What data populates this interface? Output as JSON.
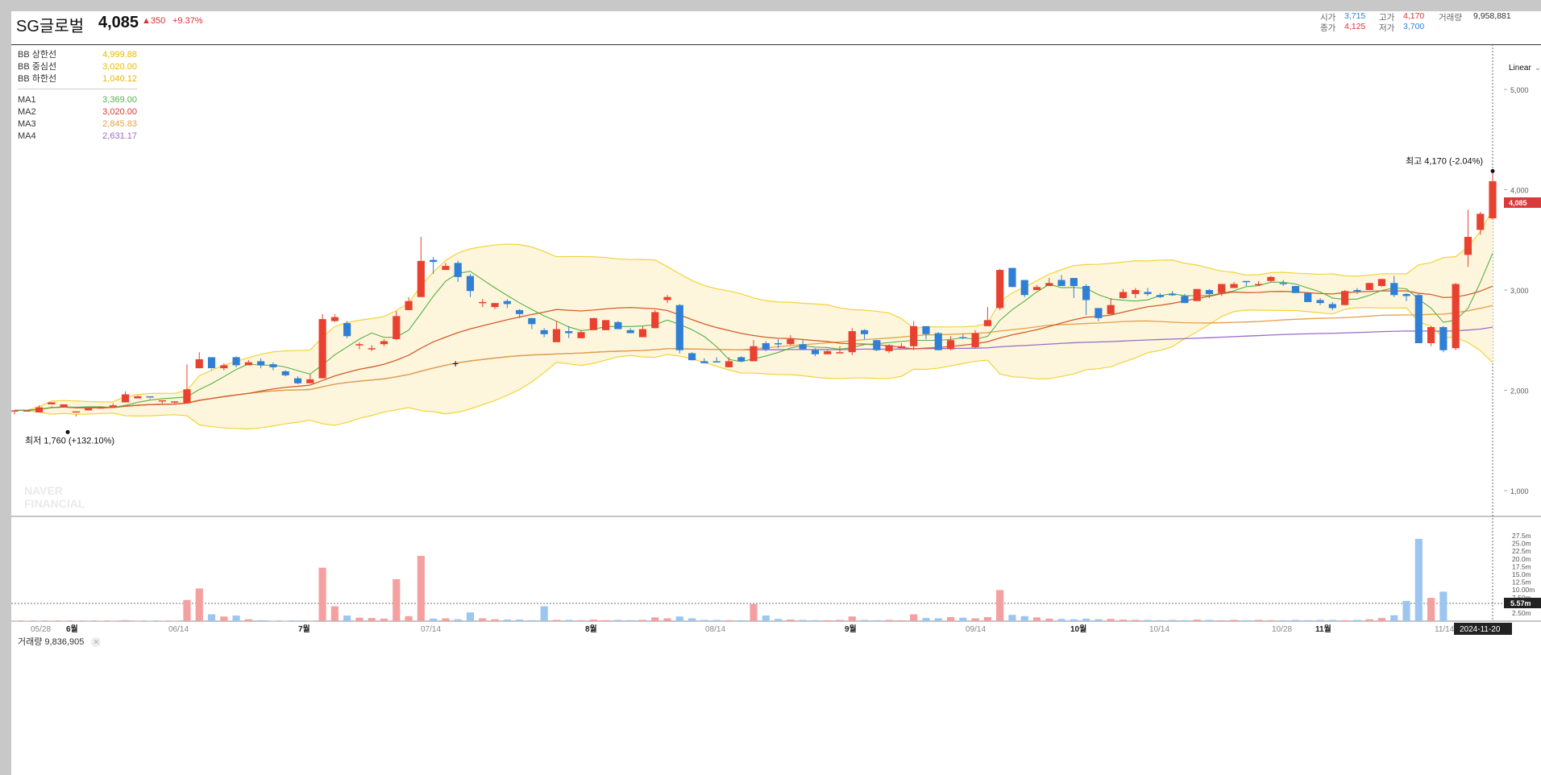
{
  "stock": {
    "name": "SG글로벌",
    "price": "4,085",
    "change": "▲350",
    "change_rate": "+9.37%"
  },
  "ohlc": {
    "open_label": "시가",
    "open": "3,715",
    "high_label": "고가",
    "high": "4,170",
    "volume_label": "거래량",
    "volume": "9,958,881",
    "close_label": "종가",
    "close": "4,125",
    "low_label": "저가",
    "low": "3,700"
  },
  "legend": {
    "bb_upper_label": "BB 상한선",
    "bb_upper": "4,999.88",
    "bb_mid_label": "BB 중심선",
    "bb_mid": "3,020.00",
    "bb_lower_label": "BB 하한선",
    "bb_lower": "1,040.12",
    "ma1_label": "MA1",
    "ma1": "3,369.00",
    "ma2_label": "MA2",
    "ma2": "3,020.00",
    "ma3_label": "MA3",
    "ma3": "2,845.83",
    "ma4_label": "MA4",
    "ma4": "2,631.17"
  },
  "scale_mode": "Linear",
  "annotations": {
    "max": "최고 4,170 (-2.04%)",
    "min": "최저 1,760 (+132.10%)",
    "watermark_line1": "NAVER",
    "watermark_line2": "FINANCIAL"
  },
  "volume_panel": {
    "label": "거래량",
    "value": "9,836,905"
  },
  "price_axis": {
    "ticks": [
      "5,000",
      "4,000",
      "3,000",
      "2,000",
      "1,000"
    ],
    "current_badge": "4,085"
  },
  "volume_axis": {
    "ticks": [
      "27.5m",
      "25.0m",
      "22.5m",
      "20.0m",
      "17.5m",
      "15.0m",
      "12.5m",
      "10.00m",
      "7.50m",
      "5.00m",
      "2.50m"
    ],
    "current_badge": "5.57m"
  },
  "time_axis": {
    "labels": [
      {
        "text": "05/28",
        "bold": false
      },
      {
        "text": "6월",
        "bold": true
      },
      {
        "text": "06/14",
        "bold": false
      },
      {
        "text": "7월",
        "bold": true
      },
      {
        "text": "07/14",
        "bold": false
      },
      {
        "text": "8월",
        "bold": true
      },
      {
        "text": "08/14",
        "bold": false
      },
      {
        "text": "9월",
        "bold": true
      },
      {
        "text": "09/14",
        "bold": false
      },
      {
        "text": "10월",
        "bold": true
      },
      {
        "text": "10/14",
        "bold": false
      },
      {
        "text": "10/28",
        "bold": false
      },
      {
        "text": "11월",
        "bold": true
      },
      {
        "text": "11/14",
        "bold": false
      }
    ],
    "current_badge": "2024-11-20"
  },
  "colors": {
    "up": "#e8412f",
    "down": "#2f7fd6",
    "vol_up": "#f4a0a0",
    "vol_down": "#9cc6f0",
    "bb_line": "#f2d33a",
    "bb_fill": "#fdf6dc",
    "ma1": "#55b04a",
    "ma2": "#d35e2c",
    "ma3": "#e6a044",
    "ma4": "#9a6cc8",
    "legend_bb": "#e8b800"
  },
  "chart_data": {
    "type": "candlestick",
    "period": "2024-05-27 ~ 2024-11-20",
    "candles_ohlc": [
      [
        1790,
        1800,
        1760,
        1790
      ],
      [
        1790,
        1800,
        1770,
        1770
      ],
      [
        1780,
        1830,
        1780,
        1850
      ],
      [
        1860,
        1880,
        1830,
        1840
      ],
      [
        1830,
        1860,
        1790,
        1790
      ],
      [
        1780,
        1790,
        1760,
        1740
      ],
      [
        1800,
        1820,
        1800,
        1820
      ],
      [
        1820,
        1830,
        1820,
        1840
      ],
      [
        1830,
        1850,
        1830,
        1870
      ],
      [
        1880,
        1960,
        1880,
        1990
      ],
      [
        1920,
        1940,
        1920,
        1950
      ],
      [
        1940,
        1930,
        1910,
        1920
      ],
      [
        1890,
        1900,
        1870,
        1900
      ],
      [
        1880,
        1890,
        1860,
        1880
      ],
      [
        1870,
        2010,
        1870,
        2260
      ],
      [
        2220,
        2310,
        2220,
        2380
      ],
      [
        2330,
        2220,
        2200,
        2210
      ],
      [
        2220,
        2250,
        2200,
        2270
      ],
      [
        2330,
        2250,
        2230,
        2340
      ],
      [
        2250,
        2280,
        2250,
        2300
      ],
      [
        2290,
        2250,
        2220,
        2320
      ],
      [
        2260,
        2230,
        2200,
        2280
      ],
      [
        2190,
        2150,
        2140,
        2200
      ],
      [
        2120,
        2070,
        2060,
        2140
      ],
      [
        2070,
        2110,
        2080,
        2160
      ],
      [
        2120,
        2710,
        2120,
        2760
      ],
      [
        2690,
        2730,
        2680,
        2760
      ],
      [
        2670,
        2540,
        2520,
        2690
      ],
      [
        2450,
        2460,
        2410,
        2480
      ],
      [
        2420,
        2420,
        2390,
        2450
      ],
      [
        2460,
        2490,
        2440,
        2510
      ],
      [
        2510,
        2740,
        2500,
        2790
      ],
      [
        2800,
        2890,
        2800,
        2930
      ],
      [
        2930,
        3290,
        2930,
        3530
      ],
      [
        3300,
        3280,
        3160,
        3330
      ],
      [
        3200,
        3240,
        3200,
        3270
      ],
      [
        3270,
        3130,
        3080,
        3290
      ],
      [
        3140,
        2990,
        2930,
        3160
      ],
      [
        2870,
        2880,
        2830,
        2910
      ],
      [
        2830,
        2870,
        2810,
        2870
      ],
      [
        2890,
        2860,
        2820,
        2910
      ],
      [
        2800,
        2760,
        2720,
        2810
      ],
      [
        2720,
        2660,
        2610,
        2720
      ],
      [
        2600,
        2560,
        2530,
        2620
      ],
      [
        2480,
        2610,
        2530,
        2690
      ],
      [
        2590,
        2570,
        2520,
        2640
      ],
      [
        2520,
        2580,
        2520,
        2600
      ],
      [
        2600,
        2720,
        2610,
        2720
      ],
      [
        2600,
        2700,
        2660,
        2700
      ],
      [
        2680,
        2610,
        2610,
        2690
      ],
      [
        2600,
        2570,
        2580,
        2620
      ],
      [
        2530,
        2610,
        2570,
        2640
      ],
      [
        2620,
        2780,
        2620,
        2800
      ],
      [
        2900,
        2930,
        2870,
        2950
      ],
      [
        2850,
        2400,
        2370,
        2860
      ],
      [
        2370,
        2300,
        2300,
        2380
      ],
      [
        2290,
        2270,
        2280,
        2320
      ],
      [
        2290,
        2280,
        2280,
        2330
      ],
      [
        2230,
        2290,
        2280,
        2330
      ],
      [
        2330,
        2290,
        2290,
        2340
      ],
      [
        2290,
        2440,
        2290,
        2500
      ],
      [
        2470,
        2410,
        2390,
        2490
      ],
      [
        2470,
        2460,
        2420,
        2510
      ],
      [
        2460,
        2510,
        2450,
        2550
      ],
      [
        2460,
        2410,
        2400,
        2500
      ],
      [
        2400,
        2360,
        2340,
        2420
      ],
      [
        2360,
        2390,
        2360,
        2400
      ],
      [
        2380,
        2380,
        2370,
        2440
      ],
      [
        2380,
        2590,
        2350,
        2620
      ],
      [
        2600,
        2560,
        2510,
        2610
      ],
      [
        2500,
        2400,
        2390,
        2500
      ],
      [
        2390,
        2450,
        2370,
        2460
      ],
      [
        2420,
        2440,
        2420,
        2470
      ],
      [
        2440,
        2640,
        2400,
        2690
      ],
      [
        2640,
        2560,
        2510,
        2630
      ],
      [
        2570,
        2400,
        2420,
        2580
      ],
      [
        2410,
        2500,
        2400,
        2540
      ],
      [
        2530,
        2520,
        2510,
        2560
      ],
      [
        2430,
        2570,
        2420,
        2600
      ],
      [
        2640,
        2700,
        2650,
        2830
      ],
      [
        2820,
        3200,
        2800,
        3210
      ],
      [
        3220,
        3030,
        3030,
        3220
      ],
      [
        3100,
        2950,
        2930,
        3080
      ],
      [
        3000,
        3030,
        3010,
        3050
      ],
      [
        3040,
        3070,
        3040,
        3120
      ],
      [
        3100,
        3040,
        3040,
        3150
      ],
      [
        3120,
        3040,
        2920,
        3080
      ],
      [
        3040,
        2900,
        2750,
        3060
      ],
      [
        2820,
        2720,
        2690,
        2820
      ],
      [
        2760,
        2850,
        2770,
        2920
      ],
      [
        2920,
        2980,
        2910,
        3010
      ],
      [
        2960,
        3000,
        2920,
        3020
      ],
      [
        2980,
        2960,
        2940,
        3020
      ],
      [
        2950,
        2930,
        2920,
        2970
      ],
      [
        2960,
        2950,
        2940,
        2990
      ],
      [
        2940,
        2870,
        2880,
        2960
      ],
      [
        2890,
        3010,
        2900,
        3010
      ],
      [
        3000,
        2960,
        2920,
        3010
      ],
      [
        2970,
        3060,
        2940,
        3060
      ],
      [
        3020,
        3060,
        3030,
        3080
      ],
      [
        3090,
        3080,
        3040,
        3090
      ],
      [
        3050,
        3060,
        3040,
        3090
      ],
      [
        3090,
        3130,
        3080,
        3140
      ],
      [
        3070,
        3060,
        3040,
        3100
      ],
      [
        3040,
        2970,
        2970,
        3040
      ],
      [
        2970,
        2880,
        2890,
        2960
      ],
      [
        2900,
        2870,
        2850,
        2920
      ],
      [
        2860,
        2820,
        2800,
        2880
      ],
      [
        2850,
        2990,
        2850,
        3000
      ],
      [
        3000,
        2990,
        2960,
        3020
      ],
      [
        3000,
        3070,
        3030,
        3070
      ],
      [
        3040,
        3110,
        3030,
        3110
      ],
      [
        3070,
        2950,
        2930,
        3140
      ],
      [
        2960,
        2940,
        2890,
        2970
      ],
      [
        2950,
        2470,
        2470,
        2960
      ],
      [
        2470,
        2630,
        2440,
        2640
      ],
      [
        2630,
        2400,
        2380,
        2640
      ],
      [
        2420,
        3060,
        2400,
        3070
      ],
      [
        3350,
        3530,
        3230,
        3800
      ],
      [
        3600,
        3760,
        3550,
        3780
      ],
      [
        3715,
        4085,
        3700,
        4170
      ]
    ],
    "ma1_last": 3369.0,
    "ma2_last": 3020.0,
    "ma3_last": 2845.83,
    "ma4_last": 2631.17,
    "bb_upper_last": 4999.88,
    "bb_mid_last": 3020.0,
    "bb_lower_last": 1040.12,
    "volume_millions": [
      0.1,
      0.1,
      0.1,
      0.1,
      0.1,
      0.1,
      0.1,
      0.1,
      0.1,
      0.3,
      0.1,
      0.1,
      0.1,
      0.1,
      6.8,
      10.5,
      2.2,
      1.5,
      1.8,
      0.6,
      0.3,
      0.1,
      0.1,
      0.2,
      0.1,
      17.2,
      4.8,
      1.8,
      1.1,
      1.0,
      0.8,
      13.5,
      1.6,
      21.0,
      0.8,
      0.9,
      0.6,
      2.8,
      0.9,
      0.6,
      0.5,
      0.5,
      0.3,
      4.8,
      0.4,
      0.4,
      0.3,
      0.5,
      0.3,
      0.4,
      0.3,
      0.4,
      1.2,
      0.9,
      1.5,
      0.9,
      0.4,
      0.4,
      0.3,
      0.3,
      5.5,
      1.8,
      0.7,
      0.5,
      0.4,
      0.3,
      0.3,
      0.4,
      1.5,
      0.4,
      0.3,
      0.4,
      0.3,
      2.2,
      1.0,
      0.9,
      1.3,
      1.1,
      0.9,
      1.3,
      10.0,
      2.0,
      1.6,
      1.2,
      0.8,
      0.7,
      0.6,
      0.8,
      0.6,
      0.7,
      0.5,
      0.4,
      0.4,
      0.3,
      0.4,
      0.3,
      0.5,
      0.4,
      0.3,
      0.4,
      0.3,
      0.4,
      0.3,
      0.3,
      0.4,
      0.3,
      0.4,
      0.4,
      0.3,
      0.4,
      0.6,
      1.0,
      1.9,
      6.5,
      26.5,
      7.5,
      9.5
    ]
  }
}
